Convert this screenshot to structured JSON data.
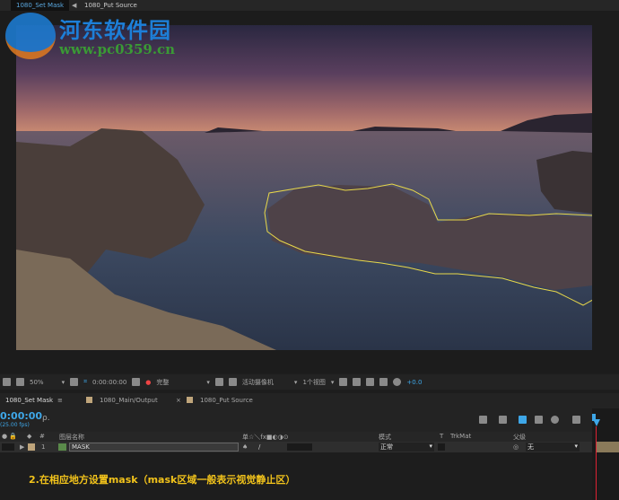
{
  "comp_tabs": [
    {
      "label": "1080_Set Mask",
      "active": true
    },
    {
      "label": "1080_Put Source",
      "active": false
    }
  ],
  "watermark": {
    "name": "河东软件园",
    "url": "www.pc0359.cn"
  },
  "viewer_toolbar": {
    "zoom": "50%",
    "timecode": "0:00:00:00",
    "resolution": "完整",
    "camera": "活动摄像机",
    "views": "1个视图",
    "exposure": "+0.0"
  },
  "panel_tabs": [
    {
      "label": "1080_Set Mask",
      "active": true
    },
    {
      "label": "1080_Main/Output"
    },
    {
      "label": "1080_Put Source"
    }
  ],
  "timeline": {
    "timecode": "0:00:00",
    "fps": "(25.00 fps)",
    "search_placeholder": "ρ."
  },
  "columns": {
    "num": "#",
    "layer_name": "图层名称",
    "switches": "单☆＼fx■◐◑⊙",
    "mode": "模式",
    "t": "T",
    "trkmat": "TrkMat",
    "parent": "父级"
  },
  "layers": [
    {
      "index": "1",
      "name": "MASK",
      "mode": "正常",
      "parent": "无",
      "label_color": "#bfa57b"
    }
  ],
  "caption": "2.在相应地方设置mask（mask区域一般表示视觉静止区）",
  "colors": {
    "mask_path": "#e8d84a",
    "timecode": "#3ea7e8",
    "caption": "#f2c31b"
  }
}
